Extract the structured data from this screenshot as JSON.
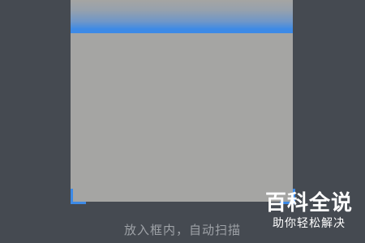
{
  "scanner": {
    "hint_text": "放入框内，自动扫描",
    "accent_color": "#3d8ae6"
  },
  "watermark": {
    "title": "百科全说",
    "subtitle": "助你轻松解决"
  }
}
